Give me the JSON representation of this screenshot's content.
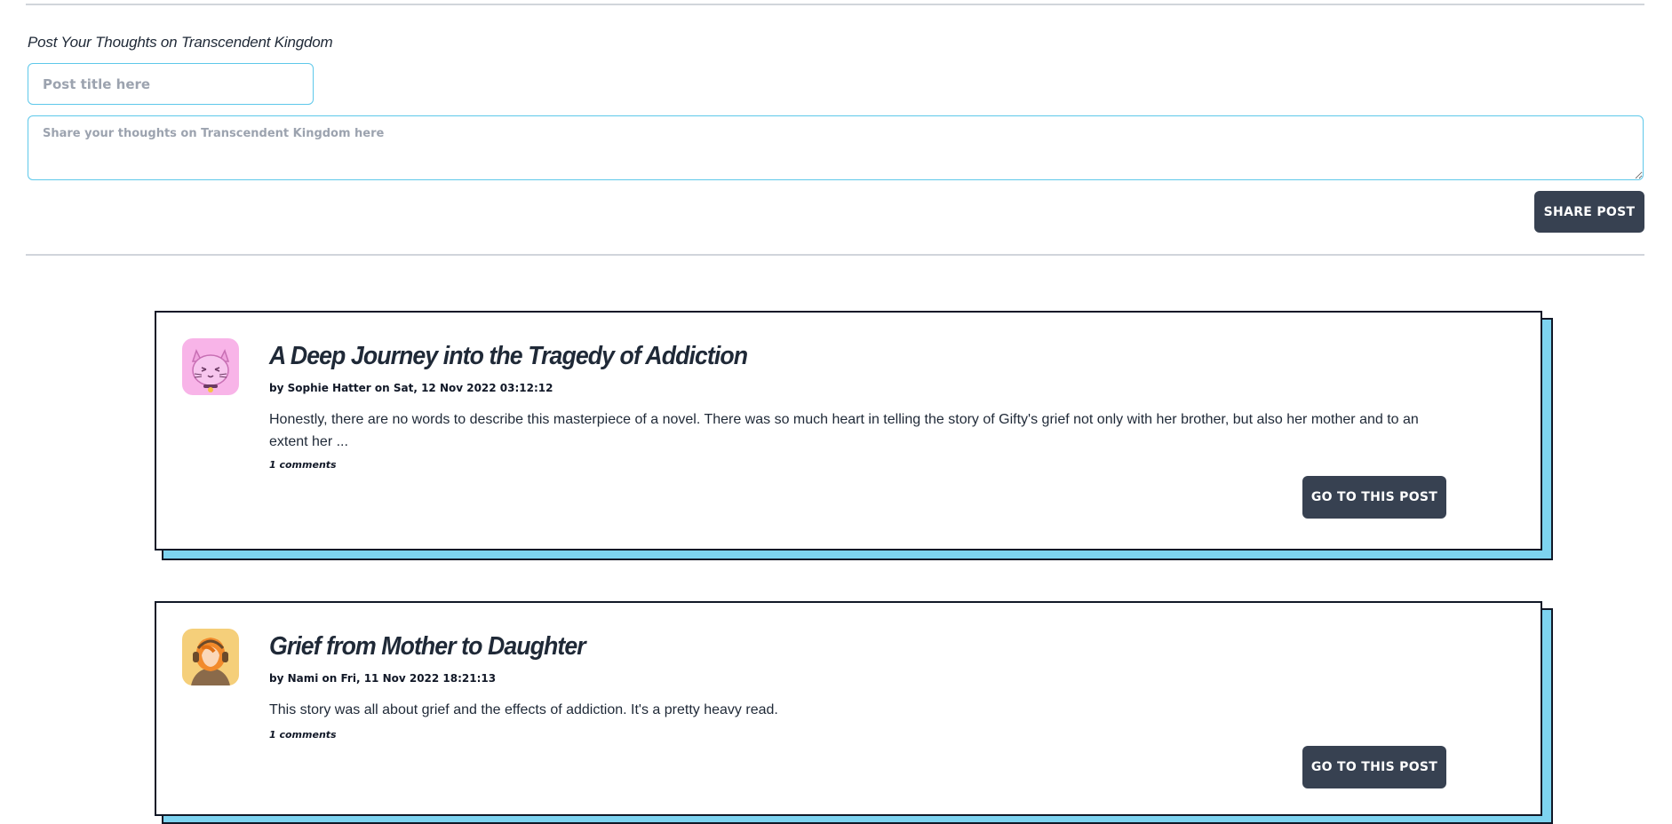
{
  "compose": {
    "heading": "Post Your Thoughts on Transcendent Kingdom",
    "title_placeholder": "Post title here",
    "body_placeholder": "Share your thoughts on Transcendent Kingdom here",
    "share_label": "SHARE POST"
  },
  "posts": [
    {
      "avatar": "pink-cat-avatar",
      "title": "A Deep Journey into the Tragedy of Addiction",
      "meta": "by Sophie Hatter on Sat, 12 Nov 2022 03:12:12",
      "excerpt": "Honestly, there are no words to describe this masterpiece of a novel. There was so much heart in telling the story of Gifty's grief not only with her brother, but also her mother and to an extent her ...",
      "comments": "1 comments",
      "button_label": "GO TO THIS POST"
    },
    {
      "avatar": "orange-hair-headphones-avatar",
      "title": "Grief from Mother to Daughter",
      "meta": "by Nami on Fri, 11 Nov 2022 18:21:13",
      "excerpt": "This story was all about grief and the effects of addiction. It's a pretty heavy read.",
      "comments": "1 comments",
      "button_label": "GO TO THIS POST"
    }
  ],
  "colors": {
    "accent": "#7dd3f0",
    "input_border": "#5ec8ea",
    "button_bg": "#374151",
    "text": "#1f2937"
  }
}
